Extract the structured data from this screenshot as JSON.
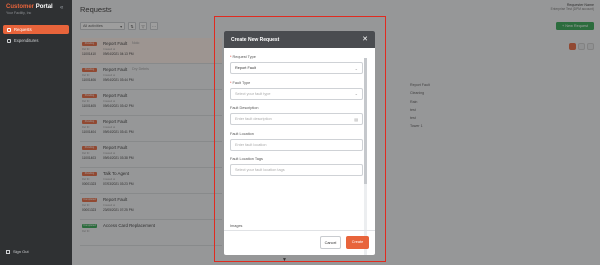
{
  "app": {
    "brand_main": "Customer",
    "brand_accent": "Portal",
    "brand_sub": "Your Facility, Inc",
    "collapse_icon": "«"
  },
  "sidebar": {
    "items": [
      {
        "label": "Requests",
        "active": true
      },
      {
        "label": "Expenditures",
        "active": false
      }
    ],
    "signout": "Sign Out"
  },
  "header": {
    "title": "Requests",
    "user_name": "Requester Name",
    "user_org": "Enterprise Test (DPM account)"
  },
  "toolbar": {
    "filter_value": "All activities",
    "new_request_label": "+ New Request"
  },
  "requests": [
    {
      "badge": "Pending",
      "badge_color": "#e8643b",
      "title": "Report Fault",
      "muted": "Nolo",
      "ref_label": "Ref ID",
      "ref": "11001410",
      "created_label": "Created at",
      "created": "09/04/2021 04:13 PM"
    },
    {
      "badge": "Pending",
      "badge_color": "#e8643b",
      "title": "Report Fault",
      "muted": "Dry Debris",
      "ref_label": "Ref ID",
      "ref": "11001406",
      "created_label": "Created at",
      "created": "09/04/2021 03:44 PM"
    },
    {
      "badge": "Pending",
      "badge_color": "#e8643b",
      "title": "Report Fault",
      "muted": "",
      "ref_label": "Ref ID",
      "ref": "11001405",
      "created_label": "Created at",
      "created": "09/04/2021 03:42 PM"
    },
    {
      "badge": "Pending",
      "badge_color": "#e8643b",
      "title": "Report Fault",
      "muted": "",
      "ref_label": "Ref ID",
      "ref": "11001404",
      "created_label": "Created at",
      "created": "09/04/2021 03:41 PM"
    },
    {
      "badge": "Pending",
      "badge_color": "#e8643b",
      "title": "Report Fault",
      "muted": "",
      "ref_label": "Ref ID",
      "ref": "11001403",
      "created_label": "Created at",
      "created": "09/04/2021 03:38 PM"
    },
    {
      "badge": "Pending",
      "badge_color": "#e8643b",
      "title": "Talk To Agent",
      "muted": "",
      "ref_label": "Ref ID",
      "ref": "00001323",
      "created_label": "Created at",
      "created": "07/03/2021 03:23 PM"
    },
    {
      "badge": "Completed",
      "badge_color": "#e8643b",
      "title": "Report Fault",
      "muted": "",
      "ref_label": "Ref ID",
      "ref": "00001323",
      "created_label": "Created at",
      "created": "23/05/2021 07:25 PM"
    },
    {
      "badge": "Completed",
      "badge_color": "#2ea44f",
      "title": "Access Card Replacement",
      "muted": "",
      "ref_label": "Ref ID",
      "ref": "",
      "created_label": "",
      "created": ""
    }
  ],
  "details": [
    "Report Fault",
    "Cleaning",
    "Rain",
    "test",
    "test",
    "Tower 1"
  ],
  "modal": {
    "title": "Create New Request",
    "close_icon": "✕",
    "fields": [
      {
        "label": "Request Type",
        "required": true,
        "value": "Report Fault",
        "placeholder": "",
        "kind": "select"
      },
      {
        "label": "Fault Type",
        "required": true,
        "value": "",
        "placeholder": "Select your fault type",
        "kind": "select"
      },
      {
        "label": "Fault Description",
        "required": false,
        "value": "",
        "placeholder": "Enter fault description",
        "kind": "textarea"
      },
      {
        "label": "Fault Location",
        "required": false,
        "value": "",
        "placeholder": "Enter fault location",
        "kind": "text"
      },
      {
        "label": "Fault Location Tags",
        "required": false,
        "value": "",
        "placeholder": "Select your fault location tags",
        "kind": "text"
      }
    ],
    "images_label": "Images",
    "cancel_label": "Cancel",
    "create_label": "Create"
  }
}
